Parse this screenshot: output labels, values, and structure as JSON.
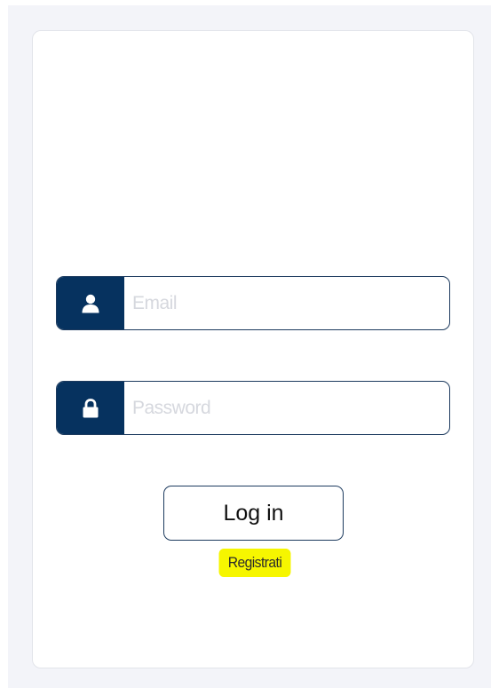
{
  "login_form": {
    "email": {
      "icon": "user-icon",
      "placeholder": "Email",
      "value": ""
    },
    "password": {
      "icon": "lock-icon",
      "placeholder": "Password",
      "value": ""
    },
    "login_button_label": "Log in",
    "register_link_label": "Registrati"
  },
  "colors": {
    "page_background": "#f3f4f9",
    "card_background": "#ffffff",
    "icon_block": "#06325f",
    "border": "#1c3a5e",
    "highlight": "#f6f600"
  }
}
